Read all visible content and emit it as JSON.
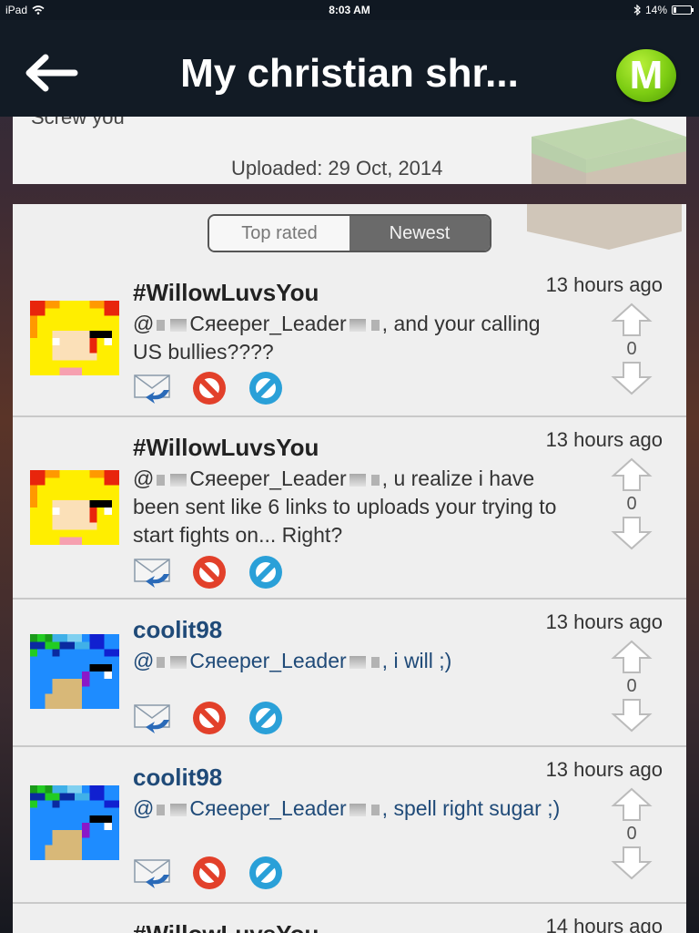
{
  "status_bar": {
    "device": "iPad",
    "time": "8:03 AM",
    "battery": "14%"
  },
  "nav": {
    "title": "My christian shr...",
    "logo_letter": "M"
  },
  "upload": {
    "description_cut": "Screw you",
    "uploaded": "Uploaded: 29 Oct, 2014"
  },
  "sort_tabs": {
    "top_rated": "Top rated",
    "newest": "Newest",
    "selected": "Newest"
  },
  "comments": [
    {
      "user": "#WillowLuvsYou",
      "time": "13 hours ago",
      "mention": "Cяeeper_Leader",
      "text": ", and your calling US bullies????",
      "votes": "0",
      "avatar": "blonde"
    },
    {
      "user": "#WillowLuvsYou",
      "time": "13 hours ago",
      "mention": "Cяeeper_Leader",
      "text": ", u realize i have been sent like 6 links to uploads your trying to start fights on... Right?",
      "votes": "0",
      "avatar": "blonde"
    },
    {
      "user": "coolit98",
      "time": "13 hours ago",
      "mention": "Cяeeper_Leader",
      "text": ", i will ;)",
      "votes": "0",
      "avatar": "blue"
    },
    {
      "user": "coolit98",
      "time": "13 hours ago",
      "mention": "Cяeeper_Leader",
      "text": ", spell right sugar ;)",
      "votes": "0",
      "avatar": "blue"
    },
    {
      "user": "#WillowLuvsYou",
      "time": "14 hours ago"
    }
  ],
  "icons": {
    "back": "back-arrow-icon",
    "reply": "reply-envelope-icon",
    "block": "block-icon",
    "report": "report-icon",
    "upvote": "thumb-up-arrow-icon",
    "downvote": "down-arrow-icon"
  },
  "colors": {
    "nav_bg": "#121b25",
    "logo_green": "#7ccc12",
    "block_red": "#e2402a",
    "report_blue": "#2aa0d8",
    "user_blue": "#1f4a78"
  }
}
